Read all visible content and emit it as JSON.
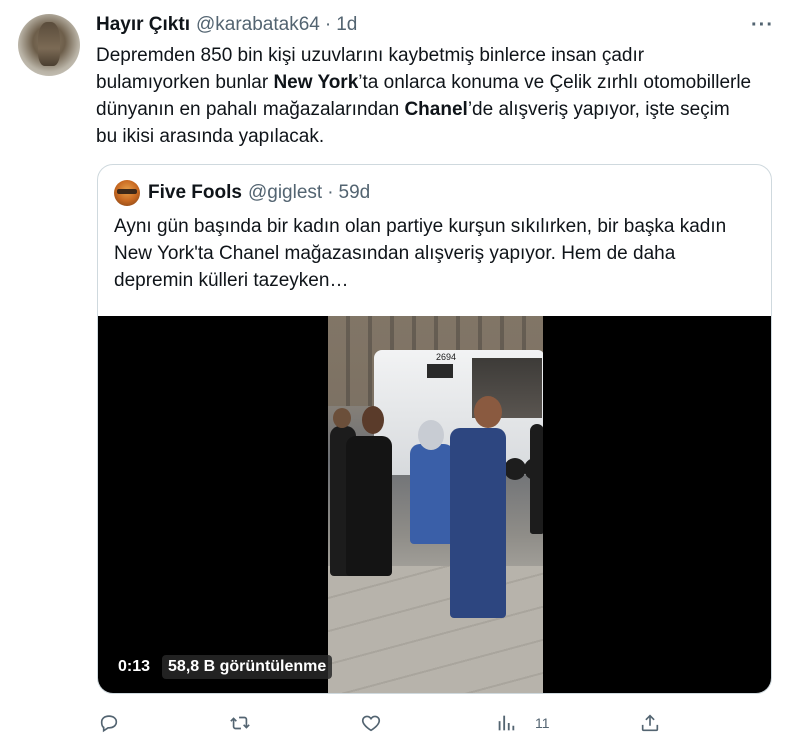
{
  "tweet": {
    "author_name": "Hayır Çıktı",
    "author_handle": "@karabatak64",
    "separator": "·",
    "time": "1d",
    "text_parts": [
      "Depremden 850 bin kişi uzuvlarını kaybetmiş binlerce insan çadır bulamıyorken bunlar ",
      "New York",
      "’ta onlarca konuma ve Çelik zırhlı otomobillerle dünyanın en pahalı mağazalarından ",
      "Chanel",
      "’de alışveriş yapıyor, işte seçim bu ikisi arasında yapılacak."
    ]
  },
  "quote": {
    "author_name": "Five Fools",
    "author_handle": "@giglest",
    "separator": "·",
    "time": "59d",
    "text": "Aynı gün başında bir kadın olan partiye kurşun sıkılırken, bir başka kadın New York'ta Chanel mağazasından alışveriş yapıyor. Hem de daha depremin külleri tazeyken…",
    "video": {
      "duration": "0:13",
      "views": "58,8 B görüntülenme",
      "bus_number": "2694"
    }
  },
  "actions": {
    "views_count": "11"
  },
  "icons": {
    "more": "more-icon",
    "reply": "reply-icon",
    "retweet": "retweet-icon",
    "like": "like-icon",
    "views": "analytics-icon",
    "share": "share-icon"
  },
  "colors": {
    "text": "#0f1419",
    "secondary": "#536471",
    "border": "#cfd9de"
  }
}
